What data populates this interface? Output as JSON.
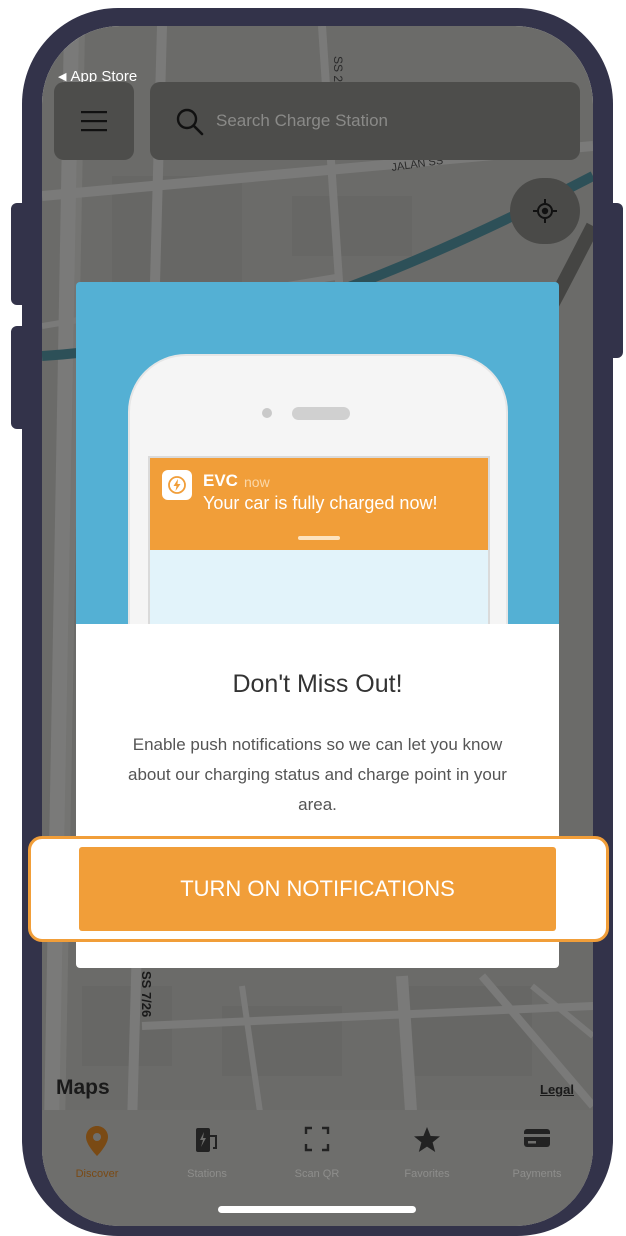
{
  "status_bar": {
    "back_label": "App Store"
  },
  "header": {
    "search_placeholder": "Search Charge Station"
  },
  "map": {
    "labels": [
      "SS 25/",
      "JALAN SS",
      "SS 7/26"
    ],
    "brand": "Maps",
    "legal": "Legal"
  },
  "modal": {
    "notification": {
      "app_name": "EVC",
      "time": "now",
      "message": "Your car is fully charged now!"
    },
    "title": "Don't Miss Out!",
    "body": "Enable push notifications so we can let you know about our charging status and charge point in your area.",
    "cta_label": "TURN ON NOTIFICATIONS"
  },
  "tabbar": {
    "tabs": [
      {
        "label": "Discover",
        "icon": "map-pin-icon",
        "active": true
      },
      {
        "label": "Stations",
        "icon": "charging-station-icon",
        "active": false
      },
      {
        "label": "Scan QR",
        "icon": "scan-qr-icon",
        "active": false
      },
      {
        "label": "Favorites",
        "icon": "star-icon",
        "active": false
      },
      {
        "label": "Payments",
        "icon": "credit-card-icon",
        "active": false
      }
    ]
  },
  "colors": {
    "accent": "#f19e39",
    "frame": "#33334a",
    "illustration_bg": "#54b0d4"
  }
}
